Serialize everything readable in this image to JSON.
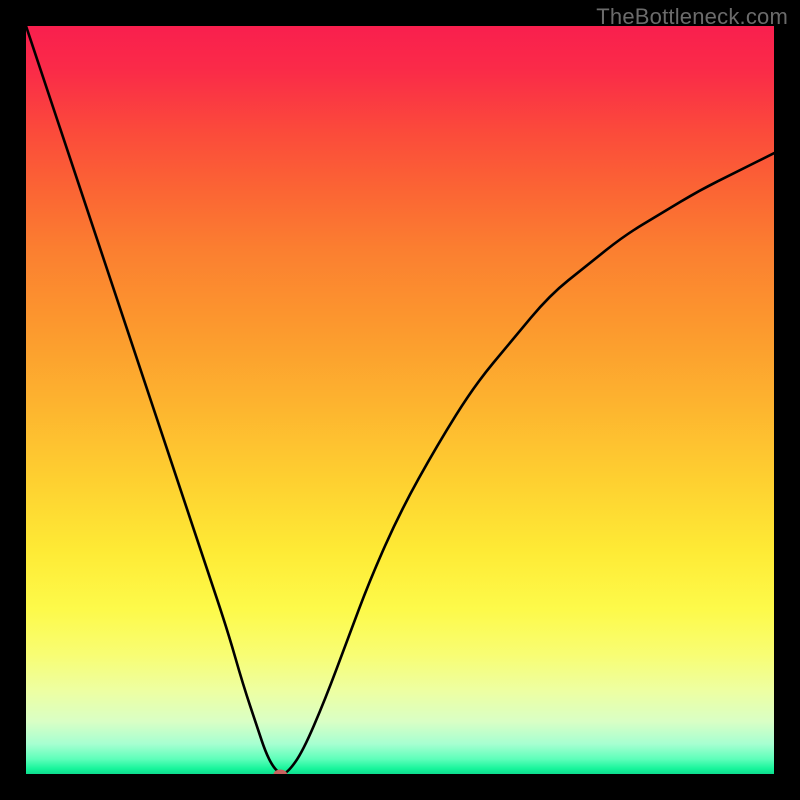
{
  "watermark": "TheBottleneck.com",
  "chart_data": {
    "type": "line",
    "title": "",
    "xlabel": "",
    "ylabel": "",
    "xlim": [
      0,
      100
    ],
    "ylim": [
      0,
      100
    ],
    "x": [
      0,
      3,
      6,
      9,
      12,
      15,
      18,
      21,
      24,
      27,
      29,
      31,
      32,
      33,
      34,
      35,
      37,
      40,
      43,
      46,
      50,
      55,
      60,
      65,
      70,
      75,
      80,
      85,
      90,
      95,
      100
    ],
    "values": [
      100,
      91,
      82,
      73,
      64,
      55,
      46,
      37,
      28,
      19,
      12,
      6,
      3,
      1,
      0,
      0.2,
      3,
      10,
      18,
      26,
      35,
      44,
      52,
      58,
      64,
      68,
      72,
      75,
      78,
      80.5,
      83
    ],
    "marker": {
      "x": 34,
      "y": 0
    },
    "background_gradient": {
      "top": "#f91f4e",
      "mid": "#fece30",
      "bottom": "#0edc8e"
    }
  }
}
